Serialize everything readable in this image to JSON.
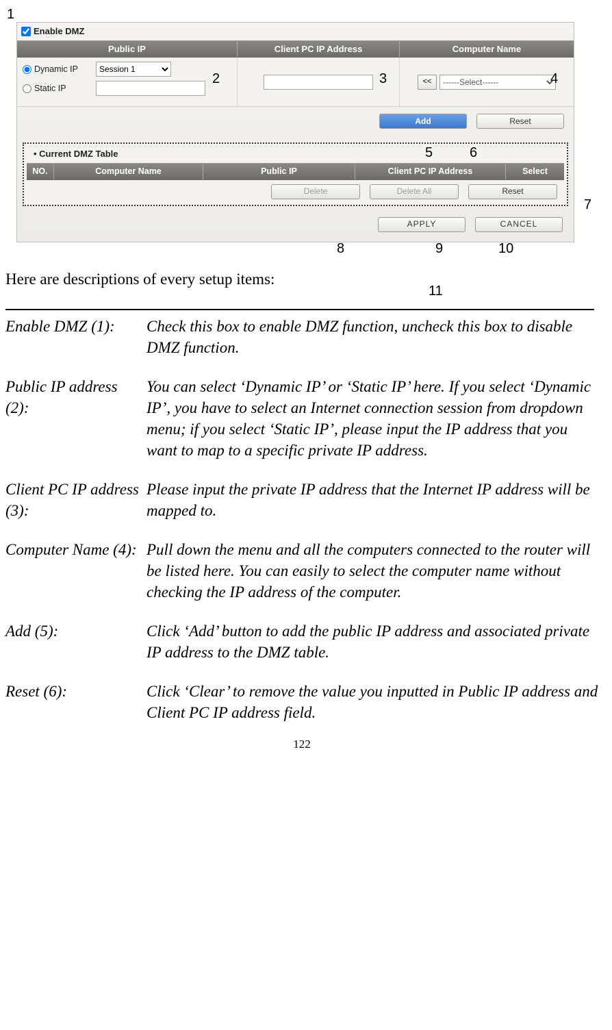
{
  "annot": {
    "a1": "1",
    "a2": "2",
    "a3": "3",
    "a4": "4",
    "a5": "5",
    "a6": "6",
    "a7": "7",
    "a8": "8",
    "a9": "9",
    "a10": "10",
    "a11": "11"
  },
  "ui": {
    "enable_label": "Enable DMZ",
    "hdr_public_ip": "Public IP",
    "hdr_client_ip": "Client PC IP Address",
    "hdr_comp_name": "Computer Name",
    "radio_dynamic": "Dynamic IP",
    "radio_static": "Static IP",
    "session_sel": "Session 1",
    "comp_sel": "------Select------",
    "lt_label": "<<",
    "btn_add": "Add",
    "btn_reset": "Reset",
    "dotted_title": "Current DMZ Table",
    "tbl_no": "NO.",
    "tbl_cn": "Computer Name",
    "tbl_pip": "Public IP",
    "tbl_cip": "Client PC IP Address",
    "tbl_sel": "Select",
    "btn_delete": "Delete",
    "btn_delete_all": "Delete All",
    "btn_reset2": "Reset",
    "btn_apply": "APPLY",
    "btn_cancel": "CANCEL"
  },
  "intro": "Here are descriptions of every setup items:",
  "descs": [
    {
      "label": "Enable DMZ (1):",
      "body": "Check this box to enable DMZ function, uncheck this box to disable DMZ function."
    },
    {
      "label": "Public IP address (2):",
      "body": "You can select ‘Dynamic IP’ or ‘Static IP’ here. If you select ‘Dynamic IP’, you have to select an Internet connection session from dropdown menu; if you select ‘Static IP’, please input the IP address that you want to map to a specific private IP address."
    },
    {
      "label": "Client PC IP address (3):",
      "body": "Please input the private IP address that the Internet IP address will be mapped to."
    },
    {
      "label": "Computer Name (4):",
      "body": "Pull down the menu and all the computers connected to the router will be listed here. You can easily to select the computer name without checking the IP address of the computer."
    },
    {
      "label": "Add (5):",
      "body": "Click ‘Add’ button to add the public IP address and associated private IP address to the DMZ table."
    },
    {
      "label": "Reset (6):",
      "body": "Click ‘Clear’ to remove the value you inputted in Public IP address and Client PC IP address field."
    }
  ],
  "page_number": "122"
}
